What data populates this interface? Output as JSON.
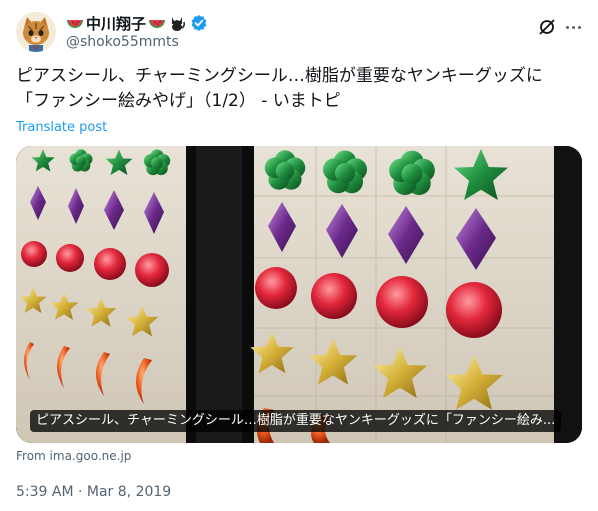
{
  "author": {
    "display_name": "中川翔子",
    "handle": "@shoko55mmts",
    "avatar_icon": "cat-avatar-icon",
    "name_emoji": [
      "watermelon-icon",
      "watermelon-icon",
      "black-cat-icon"
    ],
    "verified": true
  },
  "actions": {
    "grok_icon": "grok-icon",
    "more_icon": "more-icon"
  },
  "tweet": {
    "text": "ピアスシール、チャーミングシール…樹脂が重要なヤンキーグッズに\n「ファンシー絵みやげ」（1/2） - いまトピ",
    "translate_label": "Translate post"
  },
  "card": {
    "caption": "ピアスシール、チャーミングシール…樹脂が重要なヤンキーグッズに「ファンシー絵み...",
    "source": "From ima.goo.ne.jp"
  },
  "timestamp": "5:39 AM · Mar 8, 2019",
  "colors": {
    "link": "#1d9bf0",
    "secondary_text": "#536471",
    "verified": "#1d9bf0"
  }
}
